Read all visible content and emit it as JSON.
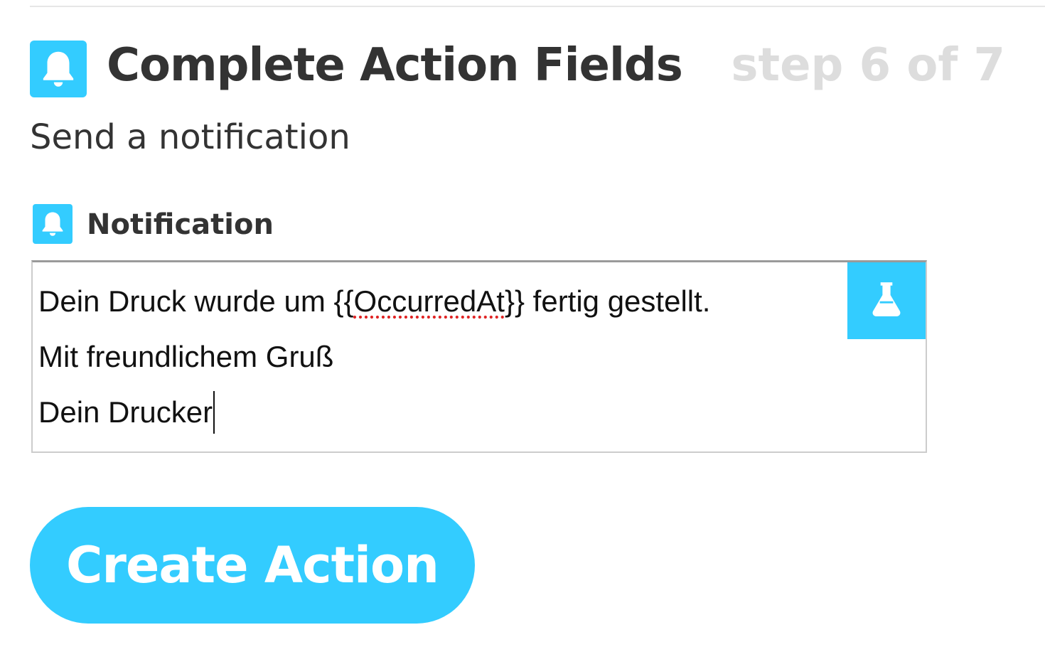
{
  "header": {
    "title": "Complete Action Fields",
    "step": "step 6 of 7",
    "icon": "bell-icon"
  },
  "subtitle": "Send a notification",
  "field": {
    "label": "Notification",
    "icon": "bell-icon",
    "lines": [
      {
        "before": "Dein Druck wurde um {{",
        "token": "OccurredAt",
        "after": "}} fertig gestellt."
      },
      {
        "text": "Mit freundlichem Gruß"
      },
      {
        "text": "Dein Drucker"
      }
    ],
    "ingredient_icon": "flask-icon"
  },
  "actions": {
    "create_label": "Create Action"
  },
  "colors": {
    "accent": "#33ccff",
    "title_text": "#333333",
    "step_text": "#dddddd",
    "spellcheck": "#e02424"
  }
}
